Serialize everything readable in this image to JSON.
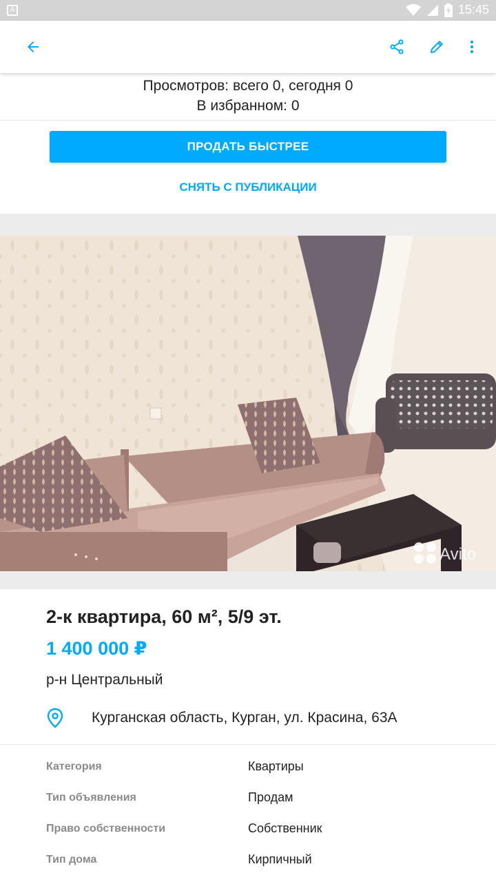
{
  "status_bar": {
    "time": "15:45",
    "icons": [
      "notification-icon",
      "wifi-icon",
      "signal-icon",
      "battery-icon"
    ]
  },
  "app_bar": {
    "icons": [
      "back-arrow-icon",
      "share-icon",
      "edit-pencil-icon",
      "more-vert-icon"
    ],
    "accent": "#00aaff"
  },
  "stats": {
    "views": "Просмотров: всего 0, сегодня 0",
    "favorites": "В избранном: 0"
  },
  "actions": {
    "sell_faster": "ПРОДАТЬ БЫСТРЕЕ",
    "unpublish": "СНЯТЬ С ПУБЛИКАЦИИ"
  },
  "photo": {
    "watermark": "Avito"
  },
  "listing": {
    "title": "2-к квартира, 60 м², 5/9 эт.",
    "price": "1 400 000 ₽",
    "district": "р-н Центральный",
    "address": "Курганская область, Курган, ул. Красина, 63А"
  },
  "params": [
    {
      "key": "Категория",
      "value": "Квартиры"
    },
    {
      "key": "Тип объявления",
      "value": "Продам"
    },
    {
      "key": "Право собственности",
      "value": "Собственник"
    },
    {
      "key": "Тип дома",
      "value": "Кирпичный"
    }
  ],
  "colors": {
    "accent": "#00aaff",
    "text": "#222222",
    "muted": "#8a8a8a",
    "status_bar": "#d4d4d4"
  }
}
